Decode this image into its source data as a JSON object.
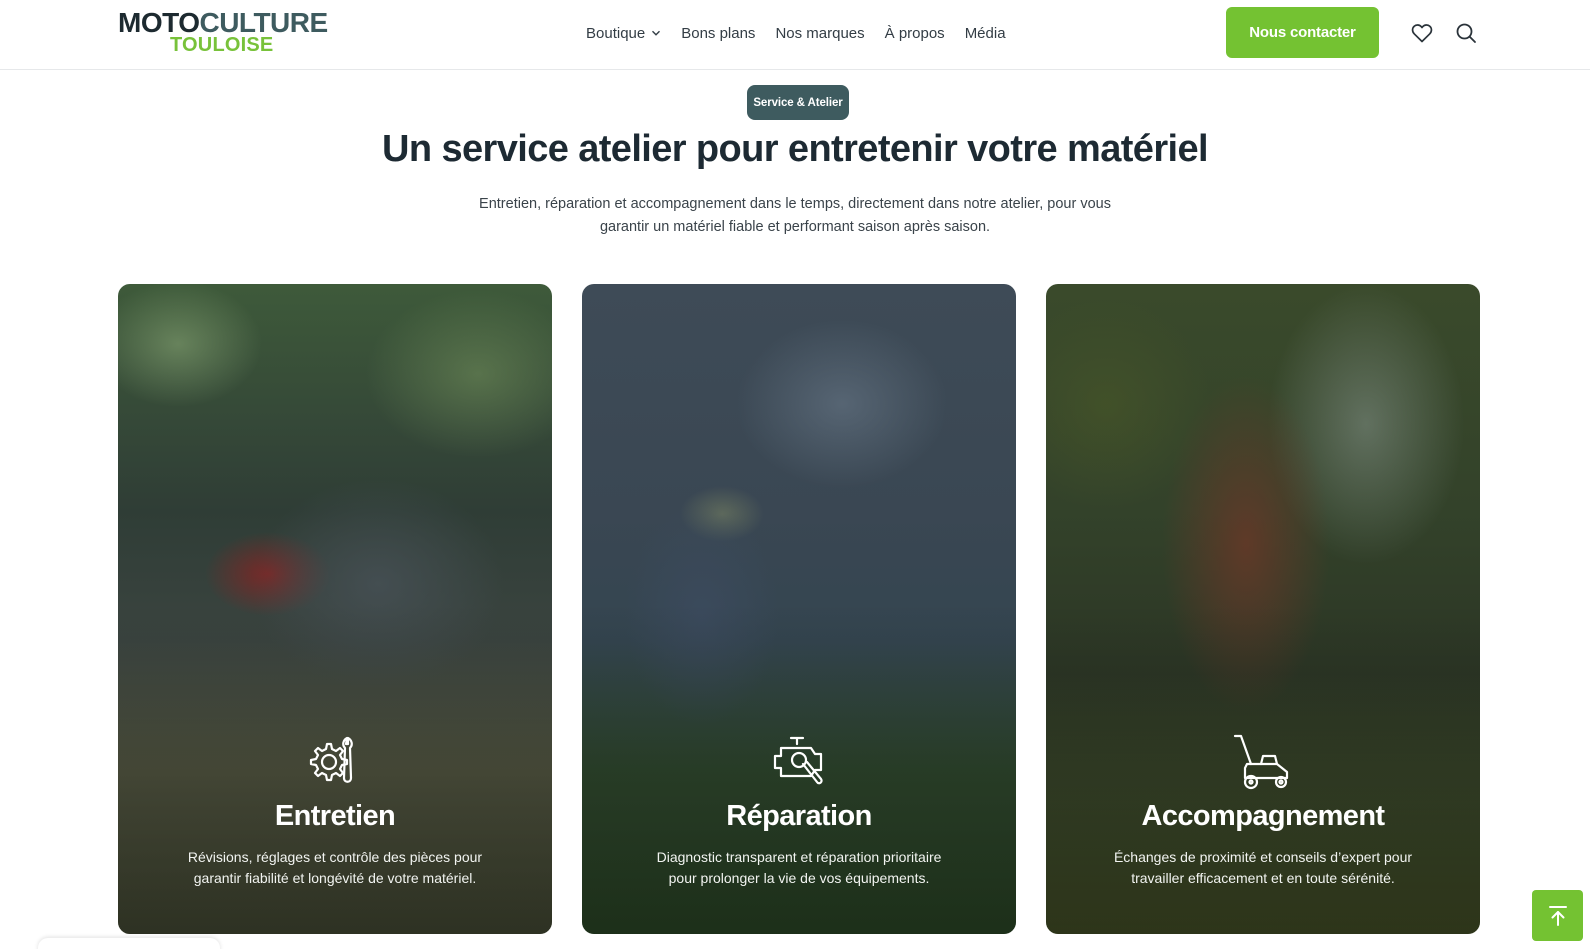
{
  "brand": {
    "logo_top_a": "MOTO",
    "logo_top_b": "CULTURE",
    "logo_bottom": "TOULOISE"
  },
  "nav": {
    "items": [
      {
        "label": "Boutique",
        "has_dropdown": true
      },
      {
        "label": "Bons plans"
      },
      {
        "label": "Nos marques"
      },
      {
        "label": "À propos"
      },
      {
        "label": "Média"
      }
    ]
  },
  "header": {
    "contact_label": "Nous contacter",
    "icons": [
      "heart-icon",
      "search-icon"
    ]
  },
  "intro": {
    "badge": "Service & Atelier",
    "title": "Un service atelier pour entretenir votre matériel",
    "subtitle_line1": "Entretien, réparation et accompagnement dans le temps, directement dans notre atelier, pour vous",
    "subtitle_line2": "garantir un matériel fiable et performant saison après saison."
  },
  "cards": [
    {
      "icon": "gear-wrench-icon",
      "title": "Entretien",
      "text_line1": "Révisions, réglages et contrôle des pièces pour",
      "text_line2": "garantir fiabilité et longévité de votre matériel."
    },
    {
      "icon": "engine-wrench-icon",
      "title": "Réparation",
      "text_line1": "Diagnostic transparent et réparation prioritaire",
      "text_line2": "pour prolonger la vie de vos équipements."
    },
    {
      "icon": "lawn-mower-icon",
      "title": "Accompagnement",
      "text_line1": "Échanges de proximité et conseils d’expert pour",
      "text_line2": "travailler efficacement et en toute sérénité."
    }
  ],
  "colors": {
    "accent": "#74c232",
    "brand_dark": "#3e5b5f",
    "text": "#1d2a33"
  }
}
